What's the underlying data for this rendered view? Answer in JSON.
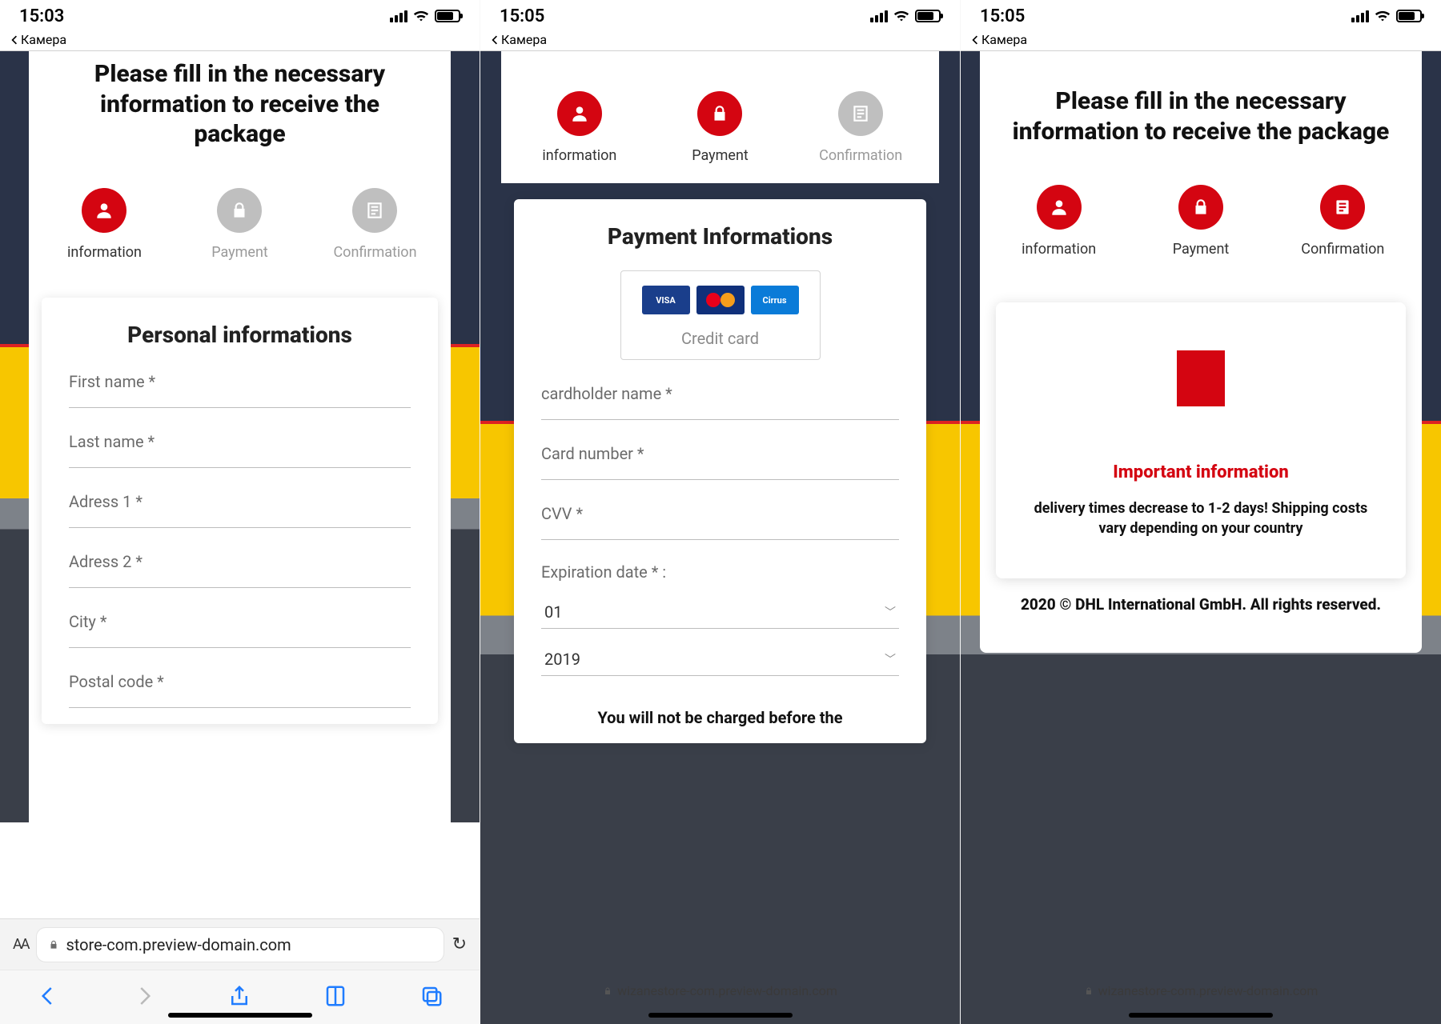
{
  "statusbar": {
    "back_label": "Камера",
    "time1": "15:03",
    "time2": "15:05",
    "time3": "15:05"
  },
  "heading": "Please fill in the necessary information to receive the package",
  "steps": {
    "information": "information",
    "payment": "Payment",
    "confirmation": "Confirmation"
  },
  "screen1": {
    "card_title": "Personal informations",
    "fields": {
      "first_name": "First name *",
      "last_name": "Last name *",
      "adress1": "Adress 1 *",
      "adress2": "Adress 2 *",
      "city": "City *",
      "postal": "Postal code *"
    },
    "url_display": "store-com.preview-domain.com"
  },
  "screen2": {
    "card_title": "Payment Informations",
    "credit_card_caption": "Credit card",
    "fields": {
      "cardholder": "cardholder name *",
      "cardnumber": "Card number *",
      "cvv": "CVV *",
      "expiration_label": "Expiration date * :",
      "month": "01",
      "year": "2019"
    },
    "note": "You will not be charged before the",
    "url_display": "wizanestore-com.preview-domain.com"
  },
  "screen3": {
    "important_title": "Important information",
    "important_text": "delivery times decrease to 1-2 days! Shipping costs vary depending on your country",
    "footer": "2020 © DHL International GmbH. All rights reserved.",
    "url_display": "wizanestore-com.preview-domain.com"
  },
  "card_brands": {
    "visa": "VISA",
    "cirrus": "Cirrus"
  }
}
